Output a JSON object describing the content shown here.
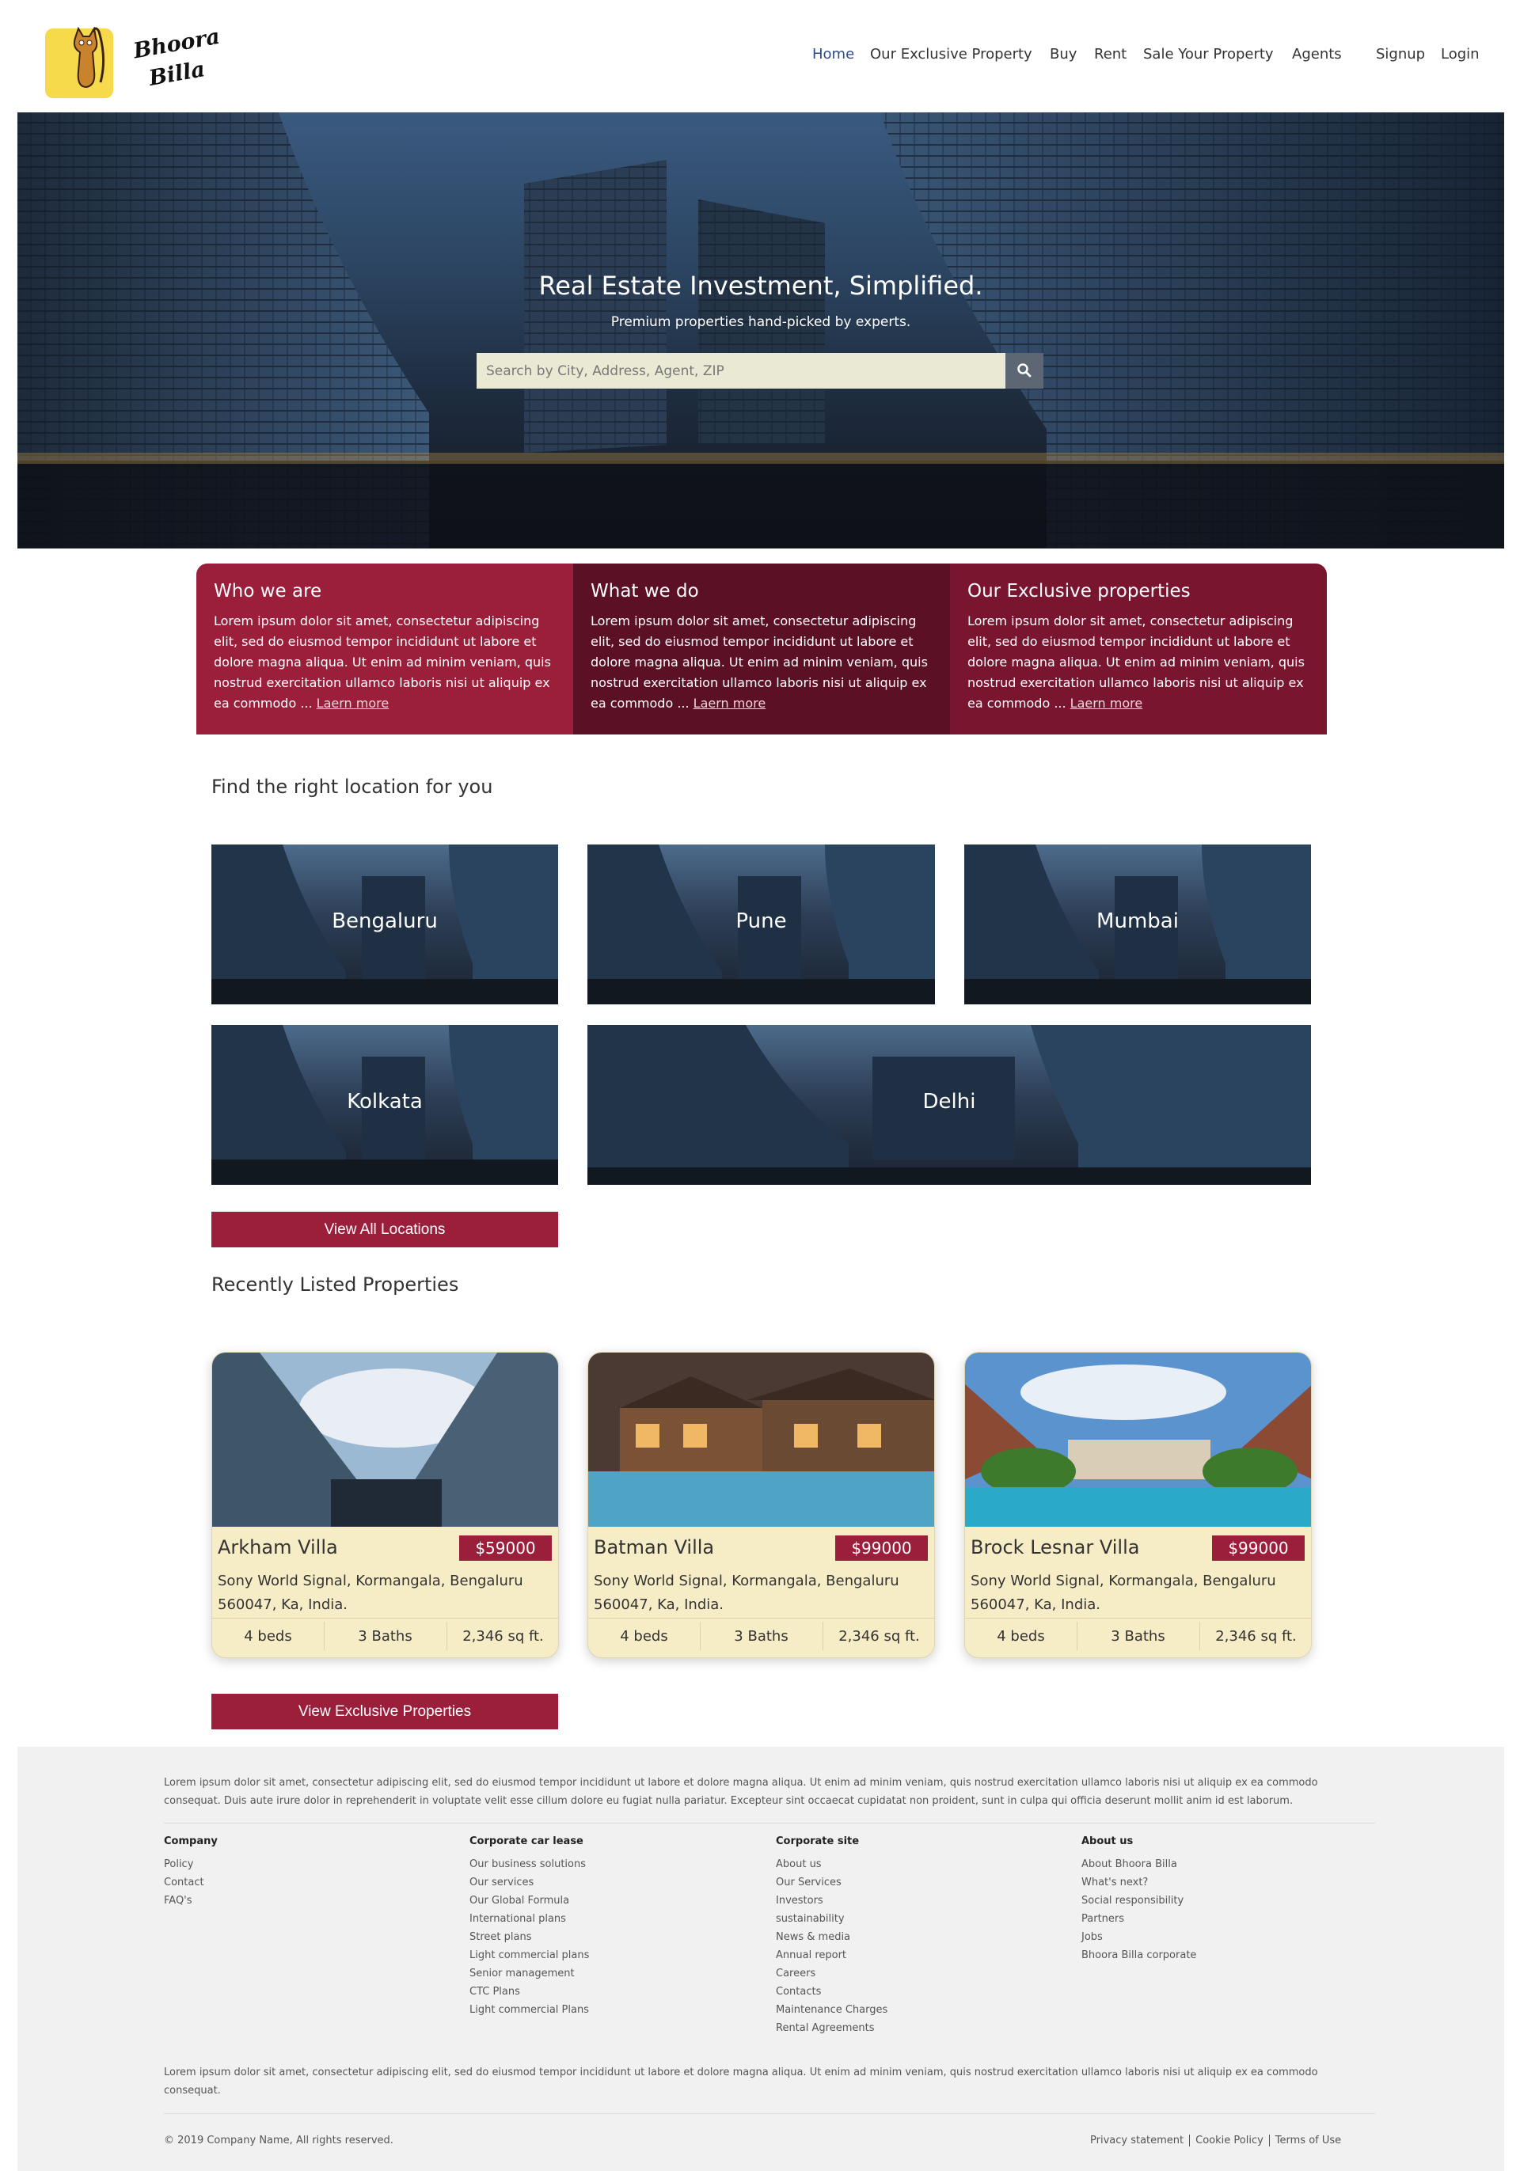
{
  "header": {
    "logo": {
      "line1": "Bhoora",
      "line2": "Billa"
    },
    "nav": [
      {
        "label": "Home",
        "active": true
      },
      {
        "label": "Our Exclusive Property"
      },
      {
        "label": "Buy"
      },
      {
        "label": "Rent"
      },
      {
        "label": "Sale Your Property"
      },
      {
        "label": "Agents"
      },
      {
        "label": "Signup"
      },
      {
        "label": "Login"
      }
    ]
  },
  "hero": {
    "title": "Real Estate Investment, Simplified.",
    "subtitle": "Premium properties hand-picked by experts.",
    "search_placeholder": "Search by City, Address, Agent, ZIP",
    "search_icon": "search-icon"
  },
  "info": [
    {
      "title": "Who we are",
      "text": "Lorem ipsum dolor sit amet, consectetur adipiscing elit, sed do eiusmod tempor incididunt ut labore et dolore magna aliqua. Ut enim ad minim veniam, quis nostrud exercitation ullamco laboris nisi ut aliquip ex ea commodo ... ",
      "more": "Laern more",
      "color": "#9b1f3b"
    },
    {
      "title": "What we do",
      "text": "Lorem ipsum dolor sit amet, consectetur adipiscing elit, sed do eiusmod tempor incididunt ut labore et dolore magna aliqua. Ut enim ad minim veniam, quis nostrud exercitation ullamco laboris nisi ut aliquip ex ea commodo ... ",
      "more": "Laern more",
      "color": "#5c1025"
    },
    {
      "title": "Our Exclusive properties",
      "text": "Lorem ipsum dolor sit amet, consectetur adipiscing elit, sed do eiusmod tempor incididunt ut labore et dolore magna aliqua. Ut enim ad minim veniam, quis nostrud exercitation ullamco laboris nisi ut aliquip ex ea commodo ... ",
      "more": "Laern more",
      "color": "#7a1530"
    }
  ],
  "locations": {
    "title": "Find the right location for you",
    "items": [
      "Bengaluru",
      "Pune",
      "Mumbai",
      "Kolkata",
      "Delhi"
    ],
    "button": "View All Locations"
  },
  "properties": {
    "title": "Recently Listed Properties",
    "items": [
      {
        "name": "Arkham Villa",
        "price": "$59000",
        "address": "Sony World Signal, Kormangala, Bengaluru 560047, Ka, India.",
        "beds": "4 beds",
        "baths": "3 Baths",
        "area": "2,346 sq ft."
      },
      {
        "name": "Batman Villa",
        "price": "$99000",
        "address": "Sony World Signal, Kormangala, Bengaluru 560047, Ka, India.",
        "beds": "4 beds",
        "baths": "3 Baths",
        "area": "2,346 sq ft."
      },
      {
        "name": "Brock Lesnar Villa",
        "price": "$99000",
        "address": "Sony World Signal, Kormangala, Bengaluru 560047, Ka, India.",
        "beds": "4 beds",
        "baths": "3 Baths",
        "area": "2,346 sq ft."
      }
    ],
    "button": "View Exclusive Properties"
  },
  "footer": {
    "intro": "Lorem ipsum dolor sit amet, consectetur adipiscing elit, sed do eiusmod tempor incididunt ut labore et dolore magna aliqua. Ut enim ad minim veniam, quis nostrud exercitation ullamco laboris nisi ut aliquip ex ea commodo consequat. Duis aute irure dolor in reprehenderit in voluptate velit esse cillum dolore eu fugiat nulla pariatur. Excepteur sint occaecat cupidatat non proident, sunt in culpa qui officia deserunt mollit anim id est laborum.",
    "columns": [
      {
        "title": "Company",
        "links": [
          "Policy",
          "Contact",
          "FAQ's"
        ]
      },
      {
        "title": "Corporate car lease",
        "links": [
          "Our business solutions",
          "Our services",
          "Our Global Formula",
          "International plans",
          "Street plans",
          "Light commercial plans",
          "Senior management",
          "CTC Plans",
          "Light commercial Plans"
        ]
      },
      {
        "title": "Corporate site",
        "links": [
          "About us",
          "Our Services",
          "Investors",
          "sustainability",
          "News & media",
          "Annual report",
          "Careers",
          "Contacts",
          "Maintenance Charges",
          "Rental Agreements"
        ]
      },
      {
        "title": "About us",
        "links": [
          "About Bhoora Billa",
          "What's next?",
          "Social responsibility",
          "Partners",
          "Jobs",
          "Bhoora Billa corporate"
        ]
      }
    ],
    "outro": "Lorem ipsum dolor sit amet, consectetur adipiscing elit, sed do eiusmod tempor incididunt ut labore et dolore magna aliqua. Ut enim ad minim veniam, quis nostrud exercitation ullamco laboris nisi ut aliquip ex ea commodo consequat.",
    "copyright": "© 2019 Company Name, All rights reserved.",
    "legal": [
      "Privacy statement",
      "Cookie Policy",
      "Terms of Use"
    ]
  },
  "colors": {
    "accent": "#9b1f3b",
    "nav_active": "#2f4a8a",
    "card_bg": "#f6ecc6"
  }
}
